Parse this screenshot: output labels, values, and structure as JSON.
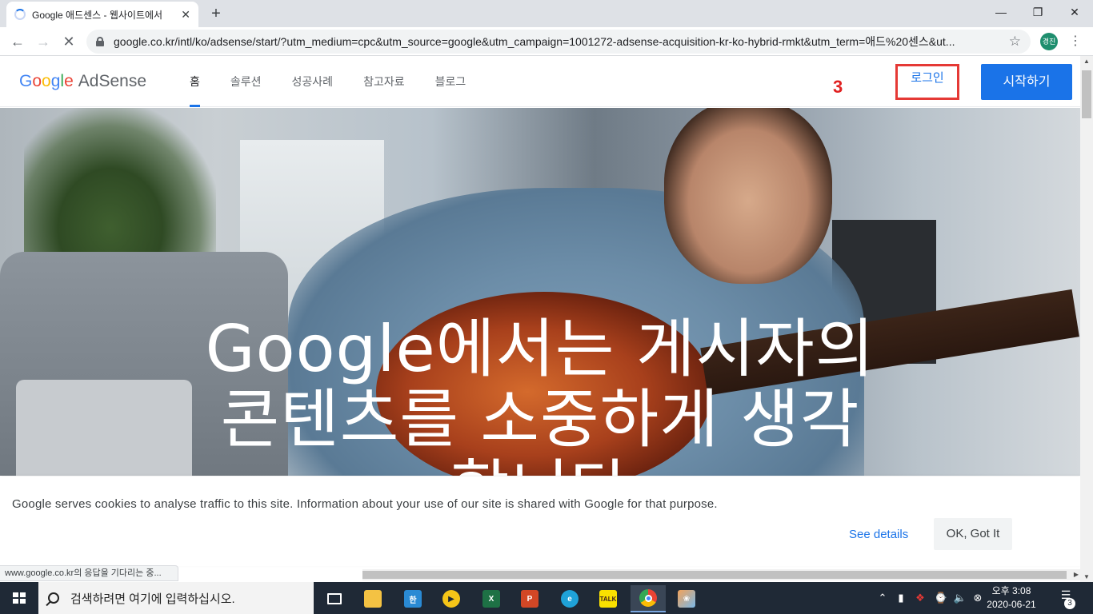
{
  "browser": {
    "tab_title": "Google 애드센스 - 웹사이트에서",
    "tab_close": "✕",
    "new_tab": "+",
    "url": "google.co.kr/intl/ko/adsense/start/?utm_medium=cpc&utm_source=google&utm_campaign=1001272-adsense-acquisition-kr-ko-hybrid-rmkt&utm_term=애드%20센스&ut...",
    "profile_initials": "경진",
    "status_text": "www.google.co.kr의 응답을 기다리는 중..."
  },
  "header": {
    "logo_google": [
      "G",
      "o",
      "o",
      "g",
      "l",
      "e"
    ],
    "logo_product": "AdSense",
    "nav": [
      {
        "label": "홈",
        "active": true
      },
      {
        "label": "솔루션",
        "active": false
      },
      {
        "label": "성공사례",
        "active": false
      },
      {
        "label": "참고자료",
        "active": false
      },
      {
        "label": "블로그",
        "active": false
      }
    ],
    "annotation_number": "3",
    "login_label": "로그인",
    "start_label": "시작하기"
  },
  "hero": {
    "title": "Google에서는 게시자의 콘텐츠를 소중하게 생각합니다"
  },
  "cookie_banner": {
    "text": "Google serves cookies to analyse traffic to this site. Information about your use of our site is shared with Google for that purpose.",
    "details_label": "See details",
    "ok_label": "OK, Got It"
  },
  "taskbar": {
    "search_placeholder": "검색하려면 여기에 입력하십시오.",
    "clock_time": "오후 3:08",
    "clock_date": "2020-06-21",
    "notification_count": "3",
    "apps": [
      {
        "name": "task-view",
        "icon": "task-view-icon"
      },
      {
        "name": "file-explorer",
        "icon": "folder-icon"
      },
      {
        "name": "hangul",
        "icon": "hangul-icon"
      },
      {
        "name": "media-player",
        "icon": "play-icon"
      },
      {
        "name": "excel",
        "icon": "excel-icon"
      },
      {
        "name": "powerpoint",
        "icon": "powerpoint-icon"
      },
      {
        "name": "edge",
        "icon": "edge-icon"
      },
      {
        "name": "kakaotalk",
        "icon": "kakaotalk-icon"
      },
      {
        "name": "chrome",
        "icon": "chrome-icon"
      },
      {
        "name": "paint",
        "icon": "paint-icon"
      }
    ]
  },
  "colors": {
    "accent": "#1a73e8",
    "annotation_red": "#e53935",
    "taskbar": "#1f2936"
  }
}
